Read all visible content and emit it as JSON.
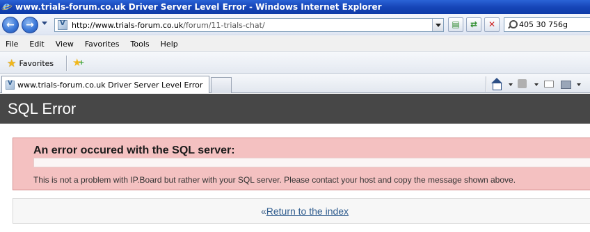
{
  "window": {
    "title": "www.trials-forum.co.uk Driver Server Level Error - Windows Internet Explorer"
  },
  "address_bar": {
    "url_prefix": "http://www.trials-forum.co.uk",
    "url_path": "/forum/11-trials-chat/"
  },
  "search": {
    "value": "405 30 756g"
  },
  "menu": [
    "File",
    "Edit",
    "View",
    "Favorites",
    "Tools",
    "Help"
  ],
  "favorites_bar": {
    "favorites_label": "Favorites"
  },
  "tabs": [
    {
      "label": "www.trials-forum.co.uk Driver Server Level Error"
    }
  ],
  "page": {
    "heading": "SQL Error",
    "error_title": "An error occured with the SQL server:",
    "error_message": "",
    "error_note": "This is not a problem with IP.Board but rather with your SQL server. Please contact your host and copy the message shown above.",
    "return_prefix": "«",
    "return_link": "Return to the index"
  },
  "colors": {
    "titlebar": "#1746b8",
    "header_bg": "#474747",
    "error_bg": "#f4c1c1",
    "link": "#2f5c8e"
  }
}
